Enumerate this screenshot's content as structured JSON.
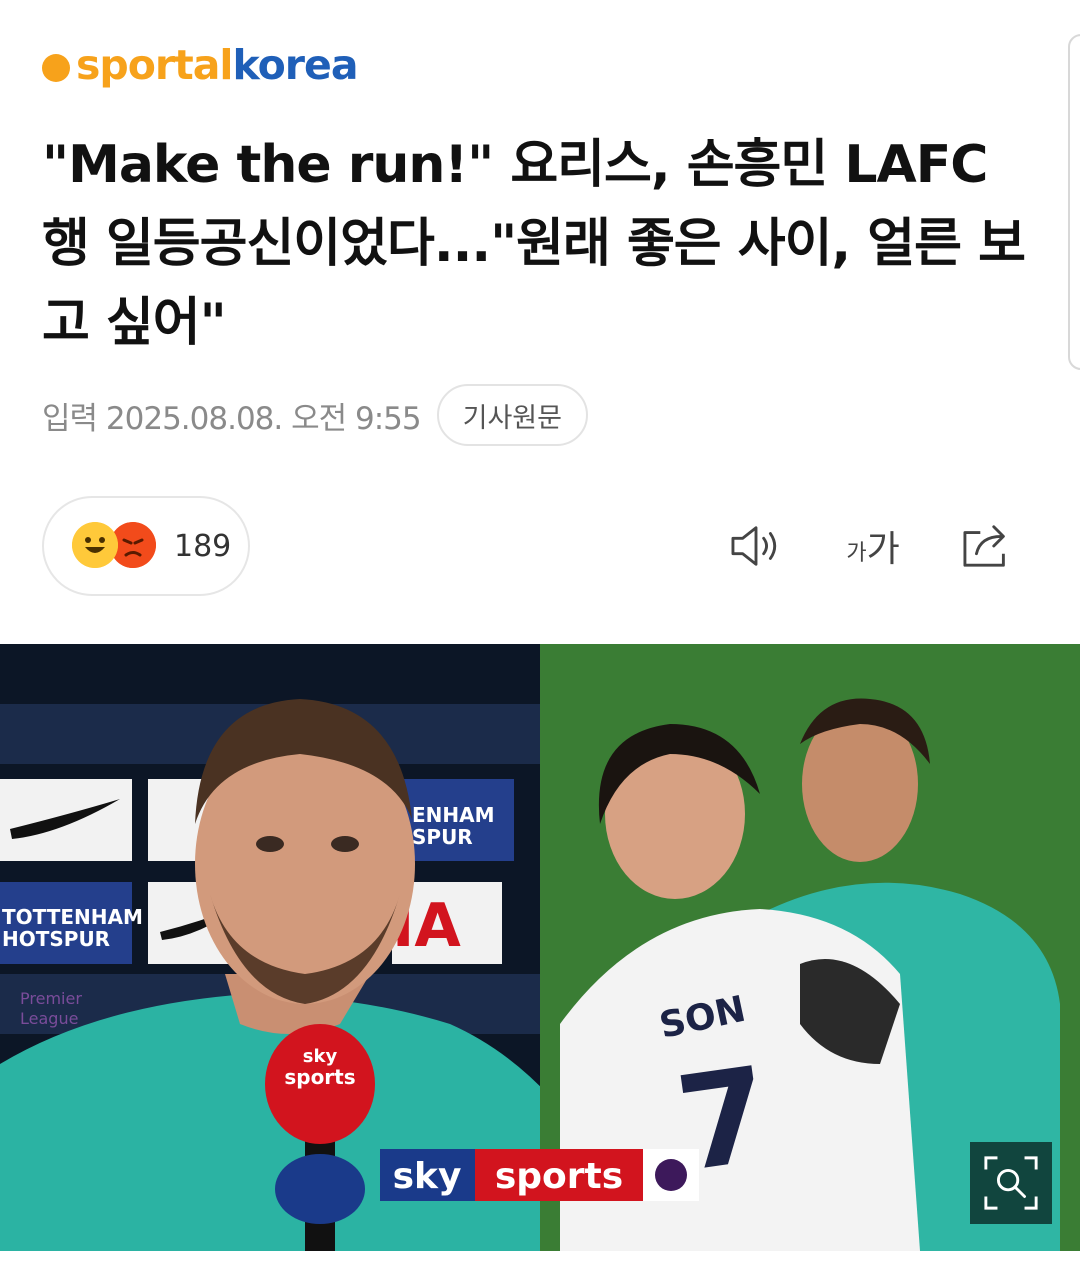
{
  "header": {
    "logo_part1": "sportal",
    "logo_part2": "korea"
  },
  "article": {
    "title": "\"Make the run!\" 요리스, 손흥민 LAFC행 일등공신이었다...\"원래 좋은 사이, 얼른 보고 싶어\"",
    "date": "입력 2025.08.08. 오전 9:55",
    "original_button": "기사원문"
  },
  "reactions": {
    "count": "189",
    "icons": [
      "happy-face",
      "angry-face"
    ]
  },
  "toolbar": {
    "icons": [
      "speaker-icon",
      "font-size-icon",
      "share-icon"
    ],
    "font_small": "가",
    "font_large": "가"
  },
  "photo": {
    "left_backdrop_text": [
      "TOTTENHAM",
      "HOTSPUR",
      "ENHAM",
      "SPUR",
      "IA",
      "Premier",
      "League"
    ],
    "mic_label": "sky\nsports",
    "broadcast_logo": "sky",
    "broadcast_logo2": "sports",
    "jersey_name": "SON",
    "jersey_number": "7",
    "icons": [
      "zoom-icon"
    ]
  },
  "colors": {
    "logo_orange": "#f7a21b",
    "logo_blue": "#1f5fb8",
    "sky_red": "#d2141e",
    "sky_blue": "#1a3a8a"
  }
}
